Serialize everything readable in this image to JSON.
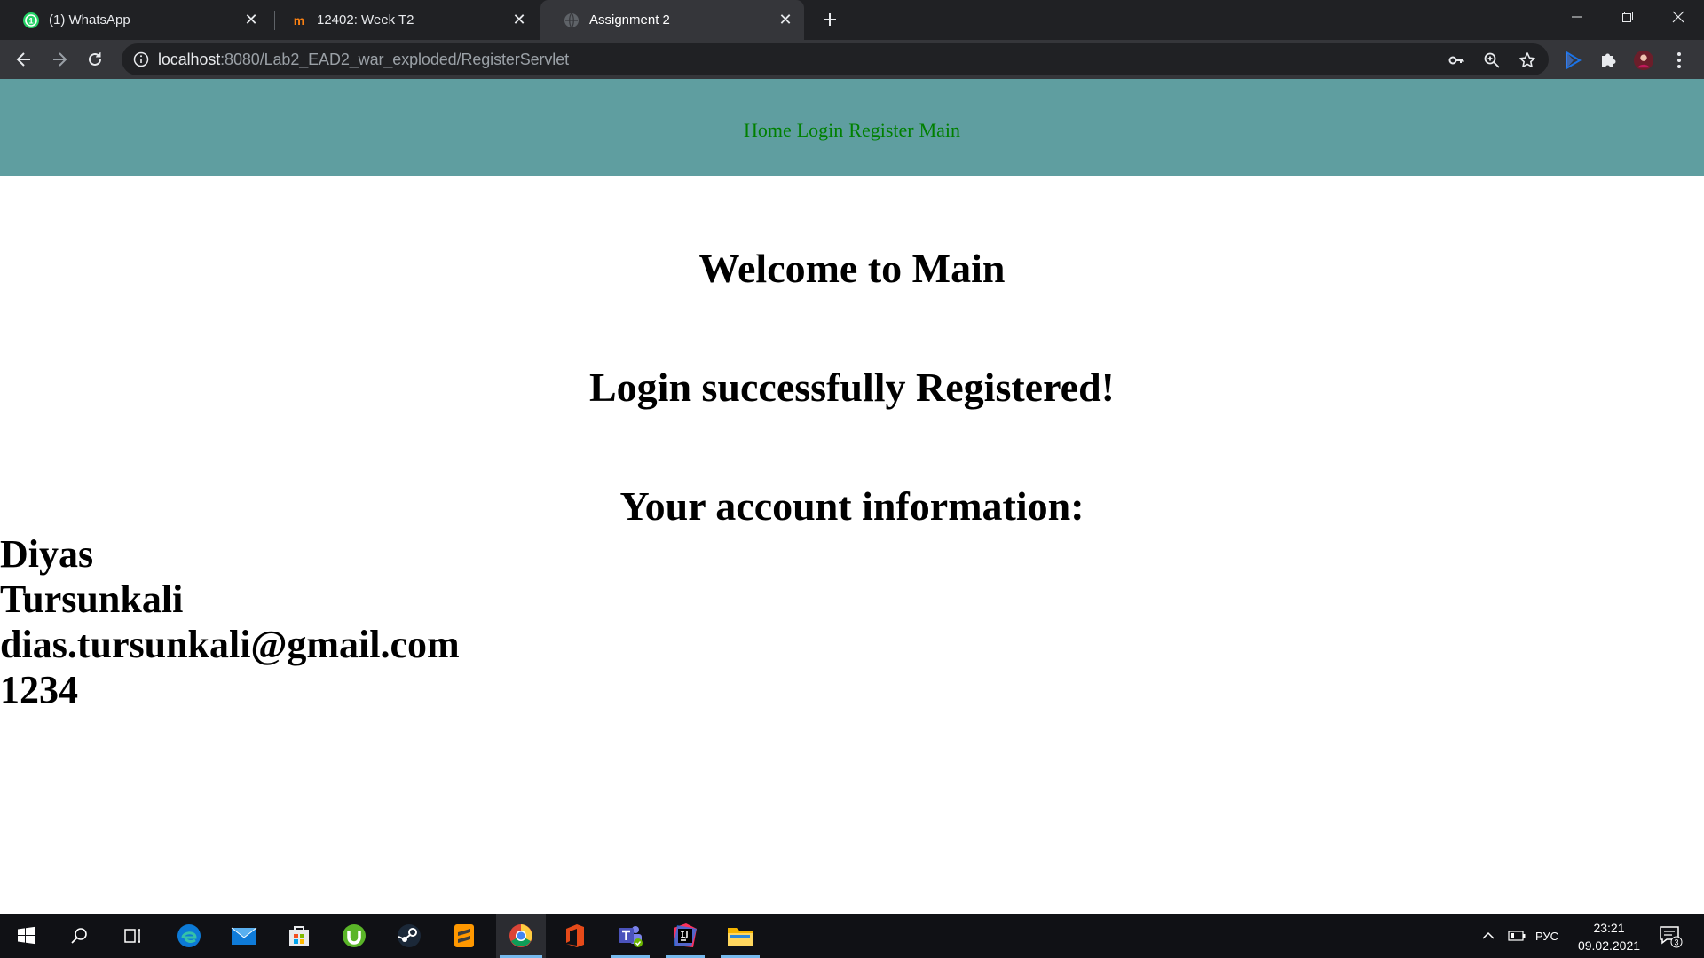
{
  "browser": {
    "tabs": [
      {
        "title": "(1) WhatsApp",
        "icon": "whatsapp-icon",
        "active": false
      },
      {
        "title": "12402: Week T2",
        "icon": "moodle-icon",
        "active": false
      },
      {
        "title": "Assignment 2",
        "icon": "globe-icon",
        "active": true
      }
    ],
    "url": {
      "host": "localhost",
      "rest": ":8080/Lab2_EAD2_war_exploded/RegisterServlet"
    }
  },
  "site": {
    "nav": [
      "Home",
      "Login",
      "Register",
      "Main"
    ],
    "heading": "Welcome to Main",
    "success_message": "Login successfully Registered!",
    "account_heading": "Your account information:",
    "account": {
      "first_name": "Diyas",
      "last_name": "Tursunkali",
      "email": "dias.tursunkali@gmail.com",
      "password": "1234"
    }
  },
  "taskbar": {
    "apps": [
      "start-icon",
      "search-icon",
      "task-view-icon",
      "edge-icon",
      "mail-icon",
      "store-icon",
      "utorrent-icon",
      "steam-icon",
      "sublime-text-icon",
      "chrome-icon",
      "office-icon",
      "teams-icon",
      "intellij-icon",
      "file-explorer-icon"
    ],
    "language": "РУС",
    "time": "23:21",
    "date": "09.02.2021",
    "notification_count": "3"
  },
  "colors": {
    "site_nav_bg": "#5f9ea0",
    "site_nav_link": "#008000",
    "chrome_dark": "#202124",
    "chrome_toolbar": "#35363a"
  }
}
